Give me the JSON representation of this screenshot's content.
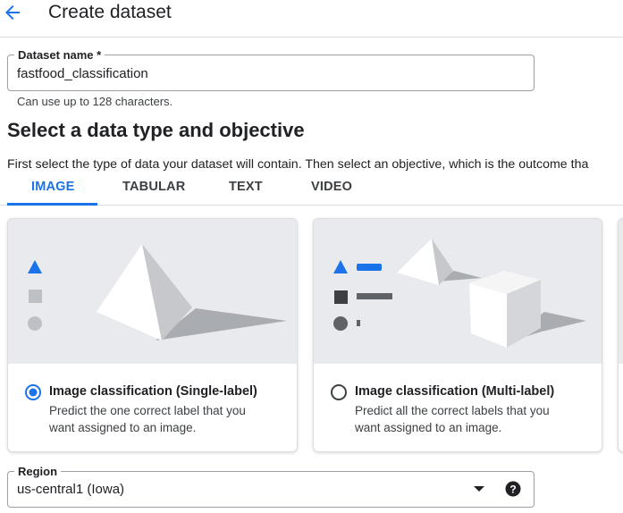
{
  "header": {
    "title": "Create dataset"
  },
  "dataset_name": {
    "label": "Dataset name *",
    "value": "fastfood_classification",
    "hint": "Can use up to 128 characters."
  },
  "section": {
    "title": "Select a data type and objective",
    "description": "First select the type of data your dataset will contain. Then select an objective, which is the outcome tha"
  },
  "tabs": [
    {
      "label": "IMAGE",
      "active": true
    },
    {
      "label": "TABULAR",
      "active": false
    },
    {
      "label": "TEXT",
      "active": false
    },
    {
      "label": "VIDEO",
      "active": false
    }
  ],
  "cards": [
    {
      "title": "Image classification (Single-label)",
      "description": "Predict the one correct label that you want assigned to an image.",
      "selected": true
    },
    {
      "title": "Image classification (Multi-label)",
      "description": "Predict all the correct labels that you want assigned to an image.",
      "selected": false
    }
  ],
  "region": {
    "label": "Region",
    "value": "us-central1 (Iowa)"
  },
  "colors": {
    "accent": "#1a73e8",
    "card_art_bg": "#e8eaed",
    "border": "#9aa0a6"
  },
  "icons": {
    "back": "arrow-back-icon",
    "dropdown": "dropdown-arrow-icon",
    "help": "help-icon"
  }
}
